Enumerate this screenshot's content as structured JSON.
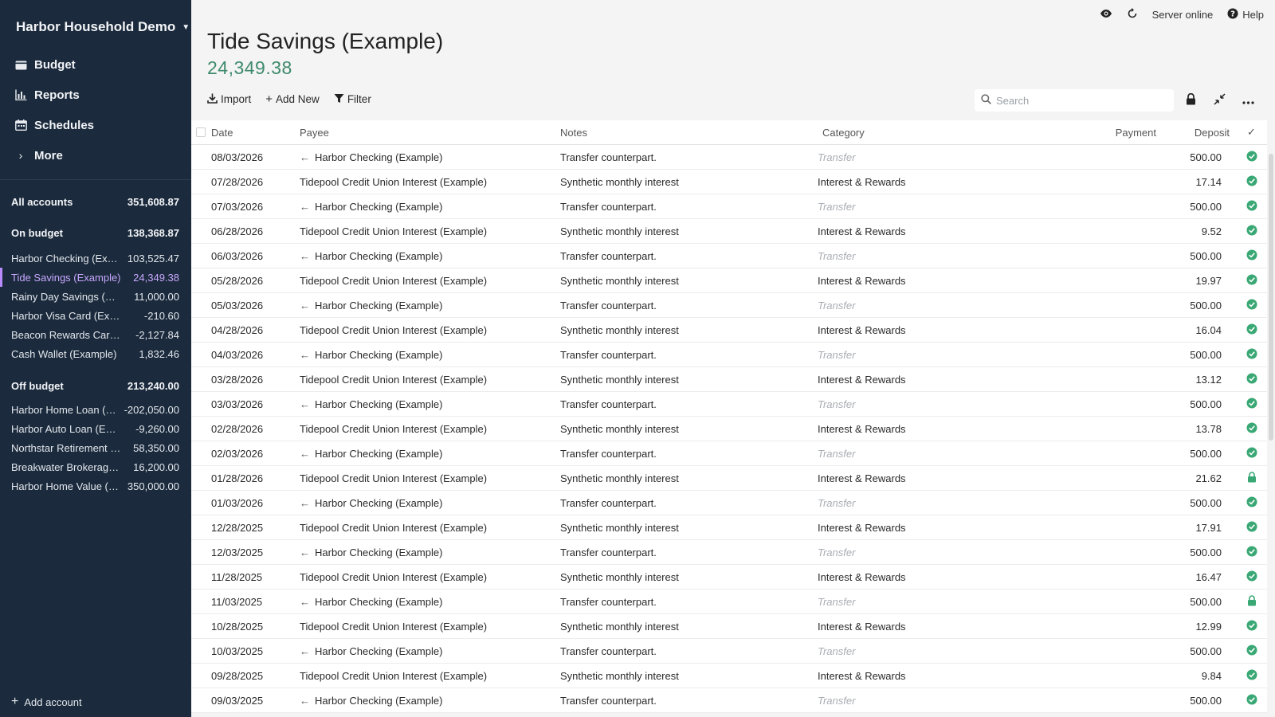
{
  "sidebar": {
    "budget_name": "Harbor Household Demo",
    "nav": [
      {
        "label": "Budget",
        "icon": "wallet-icon"
      },
      {
        "label": "Reports",
        "icon": "bar-chart-icon"
      },
      {
        "label": "Schedules",
        "icon": "calendar-icon"
      },
      {
        "label": "More",
        "icon": "chevron-right-icon"
      }
    ],
    "all_accounts": {
      "label": "All accounts",
      "amount": "351,608.87"
    },
    "on_budget": {
      "label": "On budget",
      "amount": "138,368.87",
      "accounts": [
        {
          "name": "Harbor Checking (Example)",
          "amount": "103,525.47"
        },
        {
          "name": "Tide Savings (Example)",
          "amount": "24,349.38"
        },
        {
          "name": "Rainy Day Savings (Example)",
          "amount": "11,000.00"
        },
        {
          "name": "Harbor Visa Card (Example)",
          "amount": "-210.60"
        },
        {
          "name": "Beacon Rewards Card (Example)",
          "amount": "-2,127.84"
        },
        {
          "name": "Cash Wallet (Example)",
          "amount": "1,832.46"
        }
      ]
    },
    "off_budget": {
      "label": "Off budget",
      "amount": "213,240.00",
      "accounts": [
        {
          "name": "Harbor Home Loan (Example)",
          "amount": "-202,050.00"
        },
        {
          "name": "Harbor Auto Loan (Example)",
          "amount": "-9,260.00"
        },
        {
          "name": "Northstar Retirement (Example)",
          "amount": "58,350.00"
        },
        {
          "name": "Breakwater Brokerage (Example)",
          "amount": "16,200.00"
        },
        {
          "name": "Harbor Home Value (Example)",
          "amount": "350,000.00"
        }
      ]
    },
    "add_account": "Add account"
  },
  "topbar": {
    "server_status": "Server online",
    "help": "Help"
  },
  "account": {
    "title": "Tide Savings (Example)",
    "balance": "24,349.38"
  },
  "toolbar": {
    "import": "Import",
    "add_new": "Add New",
    "filter": "Filter"
  },
  "search": {
    "placeholder": "Search"
  },
  "table": {
    "headers": {
      "date": "Date",
      "payee": "Payee",
      "notes": "Notes",
      "category": "Category",
      "payment": "Payment",
      "deposit": "Deposit",
      "cleared": "✓"
    },
    "rows": [
      {
        "date": "08/03/2026",
        "payee": "Harbor Checking (Example)",
        "transfer": true,
        "notes": "Transfer counterpart.",
        "category": "Transfer",
        "payment": "",
        "deposit": "500.00",
        "status": "cleared"
      },
      {
        "date": "07/28/2026",
        "payee": "Tidepool Credit Union Interest (Example)",
        "transfer": false,
        "notes": "Synthetic monthly interest",
        "category": "Interest & Rewards",
        "payment": "",
        "deposit": "17.14",
        "status": "cleared"
      },
      {
        "date": "07/03/2026",
        "payee": "Harbor Checking (Example)",
        "transfer": true,
        "notes": "Transfer counterpart.",
        "category": "Transfer",
        "payment": "",
        "deposit": "500.00",
        "status": "cleared"
      },
      {
        "date": "06/28/2026",
        "payee": "Tidepool Credit Union Interest (Example)",
        "transfer": false,
        "notes": "Synthetic monthly interest",
        "category": "Interest & Rewards",
        "payment": "",
        "deposit": "9.52",
        "status": "cleared"
      },
      {
        "date": "06/03/2026",
        "payee": "Harbor Checking (Example)",
        "transfer": true,
        "notes": "Transfer counterpart.",
        "category": "Transfer",
        "payment": "",
        "deposit": "500.00",
        "status": "cleared"
      },
      {
        "date": "05/28/2026",
        "payee": "Tidepool Credit Union Interest (Example)",
        "transfer": false,
        "notes": "Synthetic monthly interest",
        "category": "Interest & Rewards",
        "payment": "",
        "deposit": "19.97",
        "status": "cleared"
      },
      {
        "date": "05/03/2026",
        "payee": "Harbor Checking (Example)",
        "transfer": true,
        "notes": "Transfer counterpart.",
        "category": "Transfer",
        "payment": "",
        "deposit": "500.00",
        "status": "cleared"
      },
      {
        "date": "04/28/2026",
        "payee": "Tidepool Credit Union Interest (Example)",
        "transfer": false,
        "notes": "Synthetic monthly interest",
        "category": "Interest & Rewards",
        "payment": "",
        "deposit": "16.04",
        "status": "cleared"
      },
      {
        "date": "04/03/2026",
        "payee": "Harbor Checking (Example)",
        "transfer": true,
        "notes": "Transfer counterpart.",
        "category": "Transfer",
        "payment": "",
        "deposit": "500.00",
        "status": "cleared"
      },
      {
        "date": "03/28/2026",
        "payee": "Tidepool Credit Union Interest (Example)",
        "transfer": false,
        "notes": "Synthetic monthly interest",
        "category": "Interest & Rewards",
        "payment": "",
        "deposit": "13.12",
        "status": "cleared"
      },
      {
        "date": "03/03/2026",
        "payee": "Harbor Checking (Example)",
        "transfer": true,
        "notes": "Transfer counterpart.",
        "category": "Transfer",
        "payment": "",
        "deposit": "500.00",
        "status": "cleared"
      },
      {
        "date": "02/28/2026",
        "payee": "Tidepool Credit Union Interest (Example)",
        "transfer": false,
        "notes": "Synthetic monthly interest",
        "category": "Interest & Rewards",
        "payment": "",
        "deposit": "13.78",
        "status": "cleared"
      },
      {
        "date": "02/03/2026",
        "payee": "Harbor Checking (Example)",
        "transfer": true,
        "notes": "Transfer counterpart.",
        "category": "Transfer",
        "payment": "",
        "deposit": "500.00",
        "status": "cleared"
      },
      {
        "date": "01/28/2026",
        "payee": "Tidepool Credit Union Interest (Example)",
        "transfer": false,
        "notes": "Synthetic monthly interest",
        "category": "Interest & Rewards",
        "payment": "",
        "deposit": "21.62",
        "status": "locked"
      },
      {
        "date": "01/03/2026",
        "payee": "Harbor Checking (Example)",
        "transfer": true,
        "notes": "Transfer counterpart.",
        "category": "Transfer",
        "payment": "",
        "deposit": "500.00",
        "status": "cleared"
      },
      {
        "date": "12/28/2025",
        "payee": "Tidepool Credit Union Interest (Example)",
        "transfer": false,
        "notes": "Synthetic monthly interest",
        "category": "Interest & Rewards",
        "payment": "",
        "deposit": "17.91",
        "status": "cleared"
      },
      {
        "date": "12/03/2025",
        "payee": "Harbor Checking (Example)",
        "transfer": true,
        "notes": "Transfer counterpart.",
        "category": "Transfer",
        "payment": "",
        "deposit": "500.00",
        "status": "cleared"
      },
      {
        "date": "11/28/2025",
        "payee": "Tidepool Credit Union Interest (Example)",
        "transfer": false,
        "notes": "Synthetic monthly interest",
        "category": "Interest & Rewards",
        "payment": "",
        "deposit": "16.47",
        "status": "cleared"
      },
      {
        "date": "11/03/2025",
        "payee": "Harbor Checking (Example)",
        "transfer": true,
        "notes": "Transfer counterpart.",
        "category": "Transfer",
        "payment": "",
        "deposit": "500.00",
        "status": "locked"
      },
      {
        "date": "10/28/2025",
        "payee": "Tidepool Credit Union Interest (Example)",
        "transfer": false,
        "notes": "Synthetic monthly interest",
        "category": "Interest & Rewards",
        "payment": "",
        "deposit": "12.99",
        "status": "cleared"
      },
      {
        "date": "10/03/2025",
        "payee": "Harbor Checking (Example)",
        "transfer": true,
        "notes": "Transfer counterpart.",
        "category": "Transfer",
        "payment": "",
        "deposit": "500.00",
        "status": "cleared"
      },
      {
        "date": "09/28/2025",
        "payee": "Tidepool Credit Union Interest (Example)",
        "transfer": false,
        "notes": "Synthetic monthly interest",
        "category": "Interest & Rewards",
        "payment": "",
        "deposit": "9.84",
        "status": "cleared"
      },
      {
        "date": "09/03/2025",
        "payee": "Harbor Checking (Example)",
        "transfer": true,
        "notes": "Transfer counterpart.",
        "category": "Transfer",
        "payment": "",
        "deposit": "500.00",
        "status": "cleared"
      }
    ]
  },
  "colors": {
    "sidebar_bg": "#1b2a3c",
    "balance_green": "#3f8a6d",
    "cleared_green": "#3aa875",
    "active_account": "#c8a8ff"
  }
}
